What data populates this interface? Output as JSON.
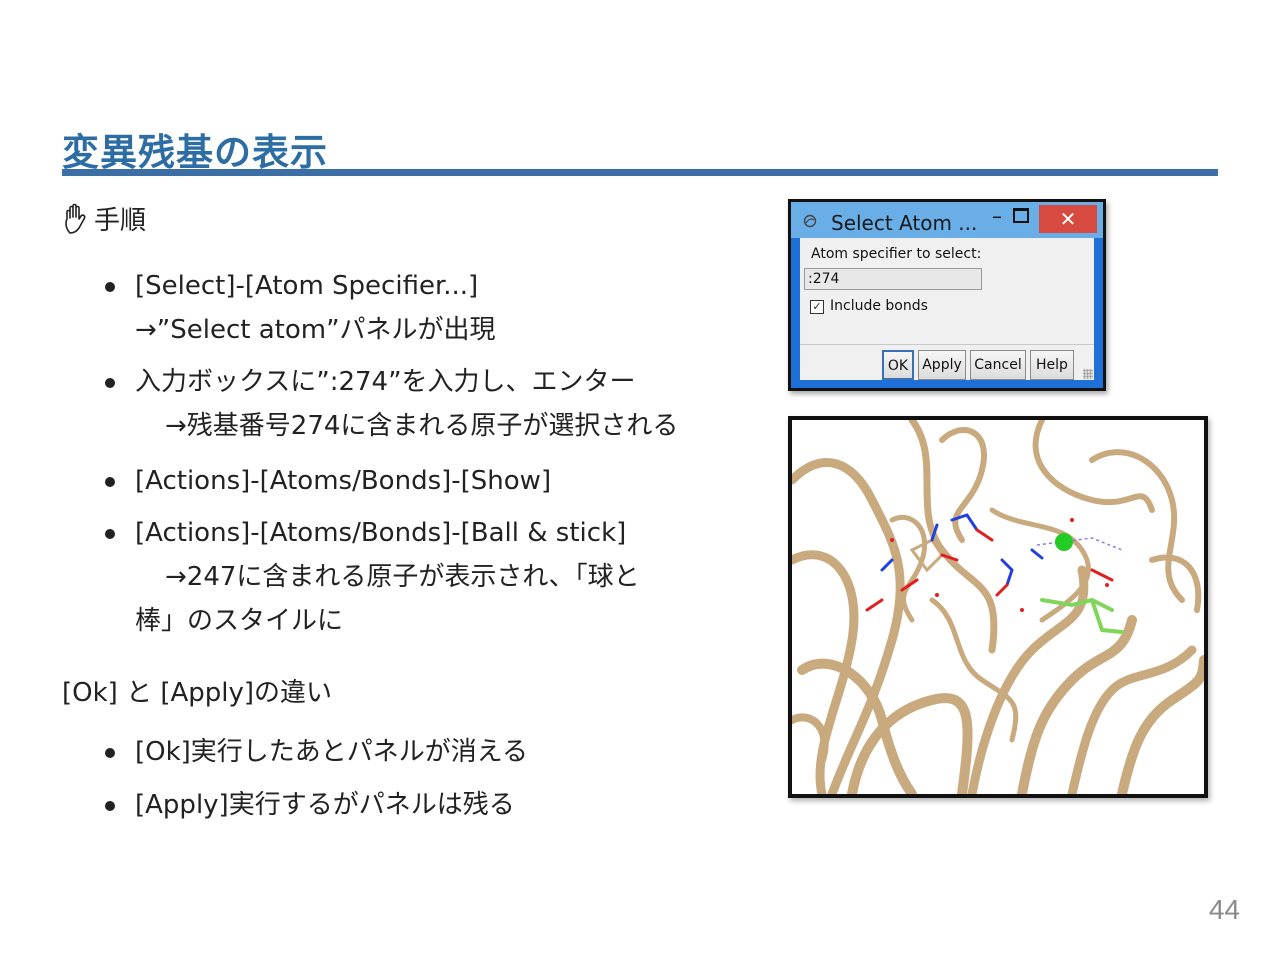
{
  "slide": {
    "title": "変異残基の表示",
    "page_number": "44"
  },
  "procedure": {
    "heading": "手順",
    "heading_icon": "hand-icon",
    "steps": [
      {
        "line1": "[Select]-[Atom Specifier...]",
        "line2": "→”Select atom”パネルが出現"
      },
      {
        "line1": "入力ボックスに”:274”を入力し、エンター",
        "line2": "→残基番号274に含まれる原子が選択される"
      },
      {
        "line1": "[Actions]-[Atoms/Bonds]-[Show]"
      },
      {
        "line1": "[Actions]-[Atoms/Bonds]-[Ball & stick]",
        "line2": "→247に含まれる原子が表示され、「球と",
        "line3": "棒」のスタイルに"
      }
    ]
  },
  "difference": {
    "heading": "[Ok] と [Apply]の違い",
    "items": [
      "[Ok]実行したあとパネルが消える",
      "[Apply]実行するがパネルは残る"
    ]
  },
  "dialog": {
    "title": "Select Atom ...",
    "close_glyph": "✕",
    "minimize_glyph": "–",
    "label": "Atom specifier to select:",
    "input_value": ":274",
    "checkbox_checked": true,
    "checkbox_label": "Include bonds",
    "buttons": {
      "ok": "OK",
      "apply": "Apply",
      "cancel": "Cancel",
      "help": "Help"
    }
  },
  "colors": {
    "title": "#2e6da4",
    "rule": "#3b6ea5",
    "ribbon": "#d2b48c",
    "oxygen": "#e02020",
    "nitrogen": "#2040e0",
    "ion": "#22cc22",
    "ligand": "#7fd65a"
  }
}
